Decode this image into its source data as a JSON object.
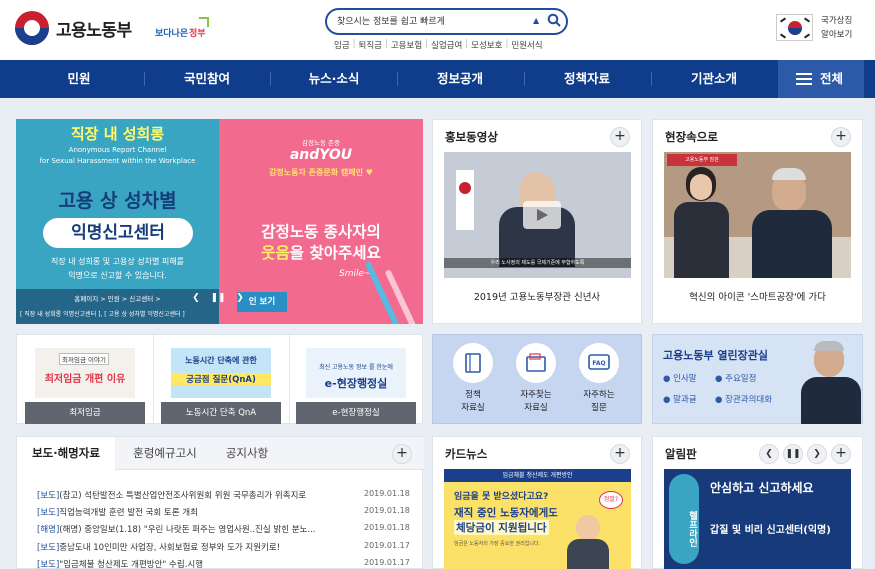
{
  "header": {
    "logo_text": "고용노동부",
    "slogan_part1": "보다나은",
    "slogan_part2": "정부",
    "search_placeholder": "찾으시는 정보를 쉽고 빠르게",
    "quick_links": [
      "임금",
      "퇴직금",
      "고용보험",
      "실업급여",
      "모성보호",
      "민원서식"
    ],
    "national_symbol_line1": "국가상징",
    "national_symbol_line2": "알아보기"
  },
  "nav": {
    "items": [
      "민원",
      "국민참여",
      "뉴스·소식",
      "정보공개",
      "정책자료",
      "기관소개"
    ],
    "all_label": "전체"
  },
  "banner": {
    "left_title": "직장 내 성희롱",
    "left_sub1": "Anonymous Report Channel",
    "left_sub2": "for Sexual Harassment within the Workplace",
    "left_heading": "고용 상 성차별",
    "left_pill": "익명신고센터",
    "left_desc1": "직장 내 성희롱 및 고용상 성차별 피해를",
    "left_desc2": "익명으로 신고할 수 있습니다.",
    "left_breadcrumb": "홈페이지 > 민원 > 신고센터 >",
    "left_links": "[ 직장 내 성희롱 익명신고센터 ], [ 고용 상 성차별 익명신고센터 ]",
    "right_small": "감정노동 존중",
    "right_and": "andYOU",
    "right_campaign": "감정노동자 존중문화 캠페인 ♥",
    "right_heading1": "감정노동 종사자의",
    "right_heading2_pre": "",
    "right_heading2_em": "웃음",
    "right_heading2_post": "을 찾아주세요",
    "right_smile": "Smile~",
    "right_button": "인 보기"
  },
  "promo_video": {
    "title": "홍보동영상",
    "caption": "2019년 고용노동부장관 신년사",
    "subtitle_strip": "우리 노사정의 제도를 국제기준에 부합하도록"
  },
  "field": {
    "title": "현장속으로",
    "caption": "혁신의 아이콘 '스마트공장'에 가다",
    "sign": "고용노동부 장관"
  },
  "promos": [
    {
      "img_top": "최저임금 이야기",
      "img_main": "최저임금 개편 이유",
      "label": "최저임금"
    },
    {
      "img_top": "노동시간 단축에 관한",
      "img_main": "궁금점 질문(QnA)",
      "label": "노동시간 단축 QnA"
    },
    {
      "img_top": "최신 고용노동 정보 를 한눈에",
      "img_main": "e-현장행정실",
      "label": "e-현장행정실"
    }
  ],
  "services": [
    {
      "label1": "정책",
      "label2": "자료실"
    },
    {
      "label1": "자주찾는",
      "label2": "자료실"
    },
    {
      "label1": "자주하는",
      "label2": "질문"
    }
  ],
  "minister_room": {
    "title": "고용노동부 열린장관실",
    "tags": [
      "인사말",
      "주요일정",
      "말과글",
      "장관과의대화"
    ]
  },
  "board": {
    "tabs": [
      "보도·해명자료",
      "훈령예규고시",
      "공지사항"
    ],
    "rows": [
      {
        "cat": "[보도]",
        "text": "(참고) 석탄발전소 특별산업안전조사위원회 위원 국무총리가 위촉지로",
        "date": "2019.01.18"
      },
      {
        "cat": "[보도]",
        "text": "직업능력개발 훈련 발전 국회 토론 개최",
        "date": "2019.01.18"
      },
      {
        "cat": "[해명]",
        "text": "(해명) 중앙일보(1.18) \"우린 나랏돈 퍼주는 영업사원..진실 밝힌 분노...",
        "date": "2019.01.18"
      },
      {
        "cat": "[보도]",
        "text": "중남도내 10인미만 사업장, 사회보험료 정부와 도가 지원키로!",
        "date": "2019.01.17"
      },
      {
        "cat": "[보도]",
        "text": "\"임금체불 청산제도 개편방안\" 수립.시행",
        "date": "2019.01.17"
      }
    ]
  },
  "card_news": {
    "title": "카드뉴스",
    "strip": "임금체불 청산제도 개편방안",
    "line1": "임금을 못 받으셨다고요?",
    "line2": "재직 중인 노동자에게도",
    "line3": "체당금이 지원됩니다",
    "bubble": "정말?",
    "footnote": "임금은 노동자의 가장 중요한 권리입니다."
  },
  "notice_board": {
    "title": "알림판",
    "brand": "헬프라인",
    "line1": "안심하고 신고하세요",
    "line2": "갑질 및 비리 신고센터(익명)"
  },
  "colors": {
    "nav": "#0f3d8c",
    "accent": "#1f4e9c",
    "page_bg": "#e9edf4",
    "date_gold": "#8a6d1a"
  }
}
